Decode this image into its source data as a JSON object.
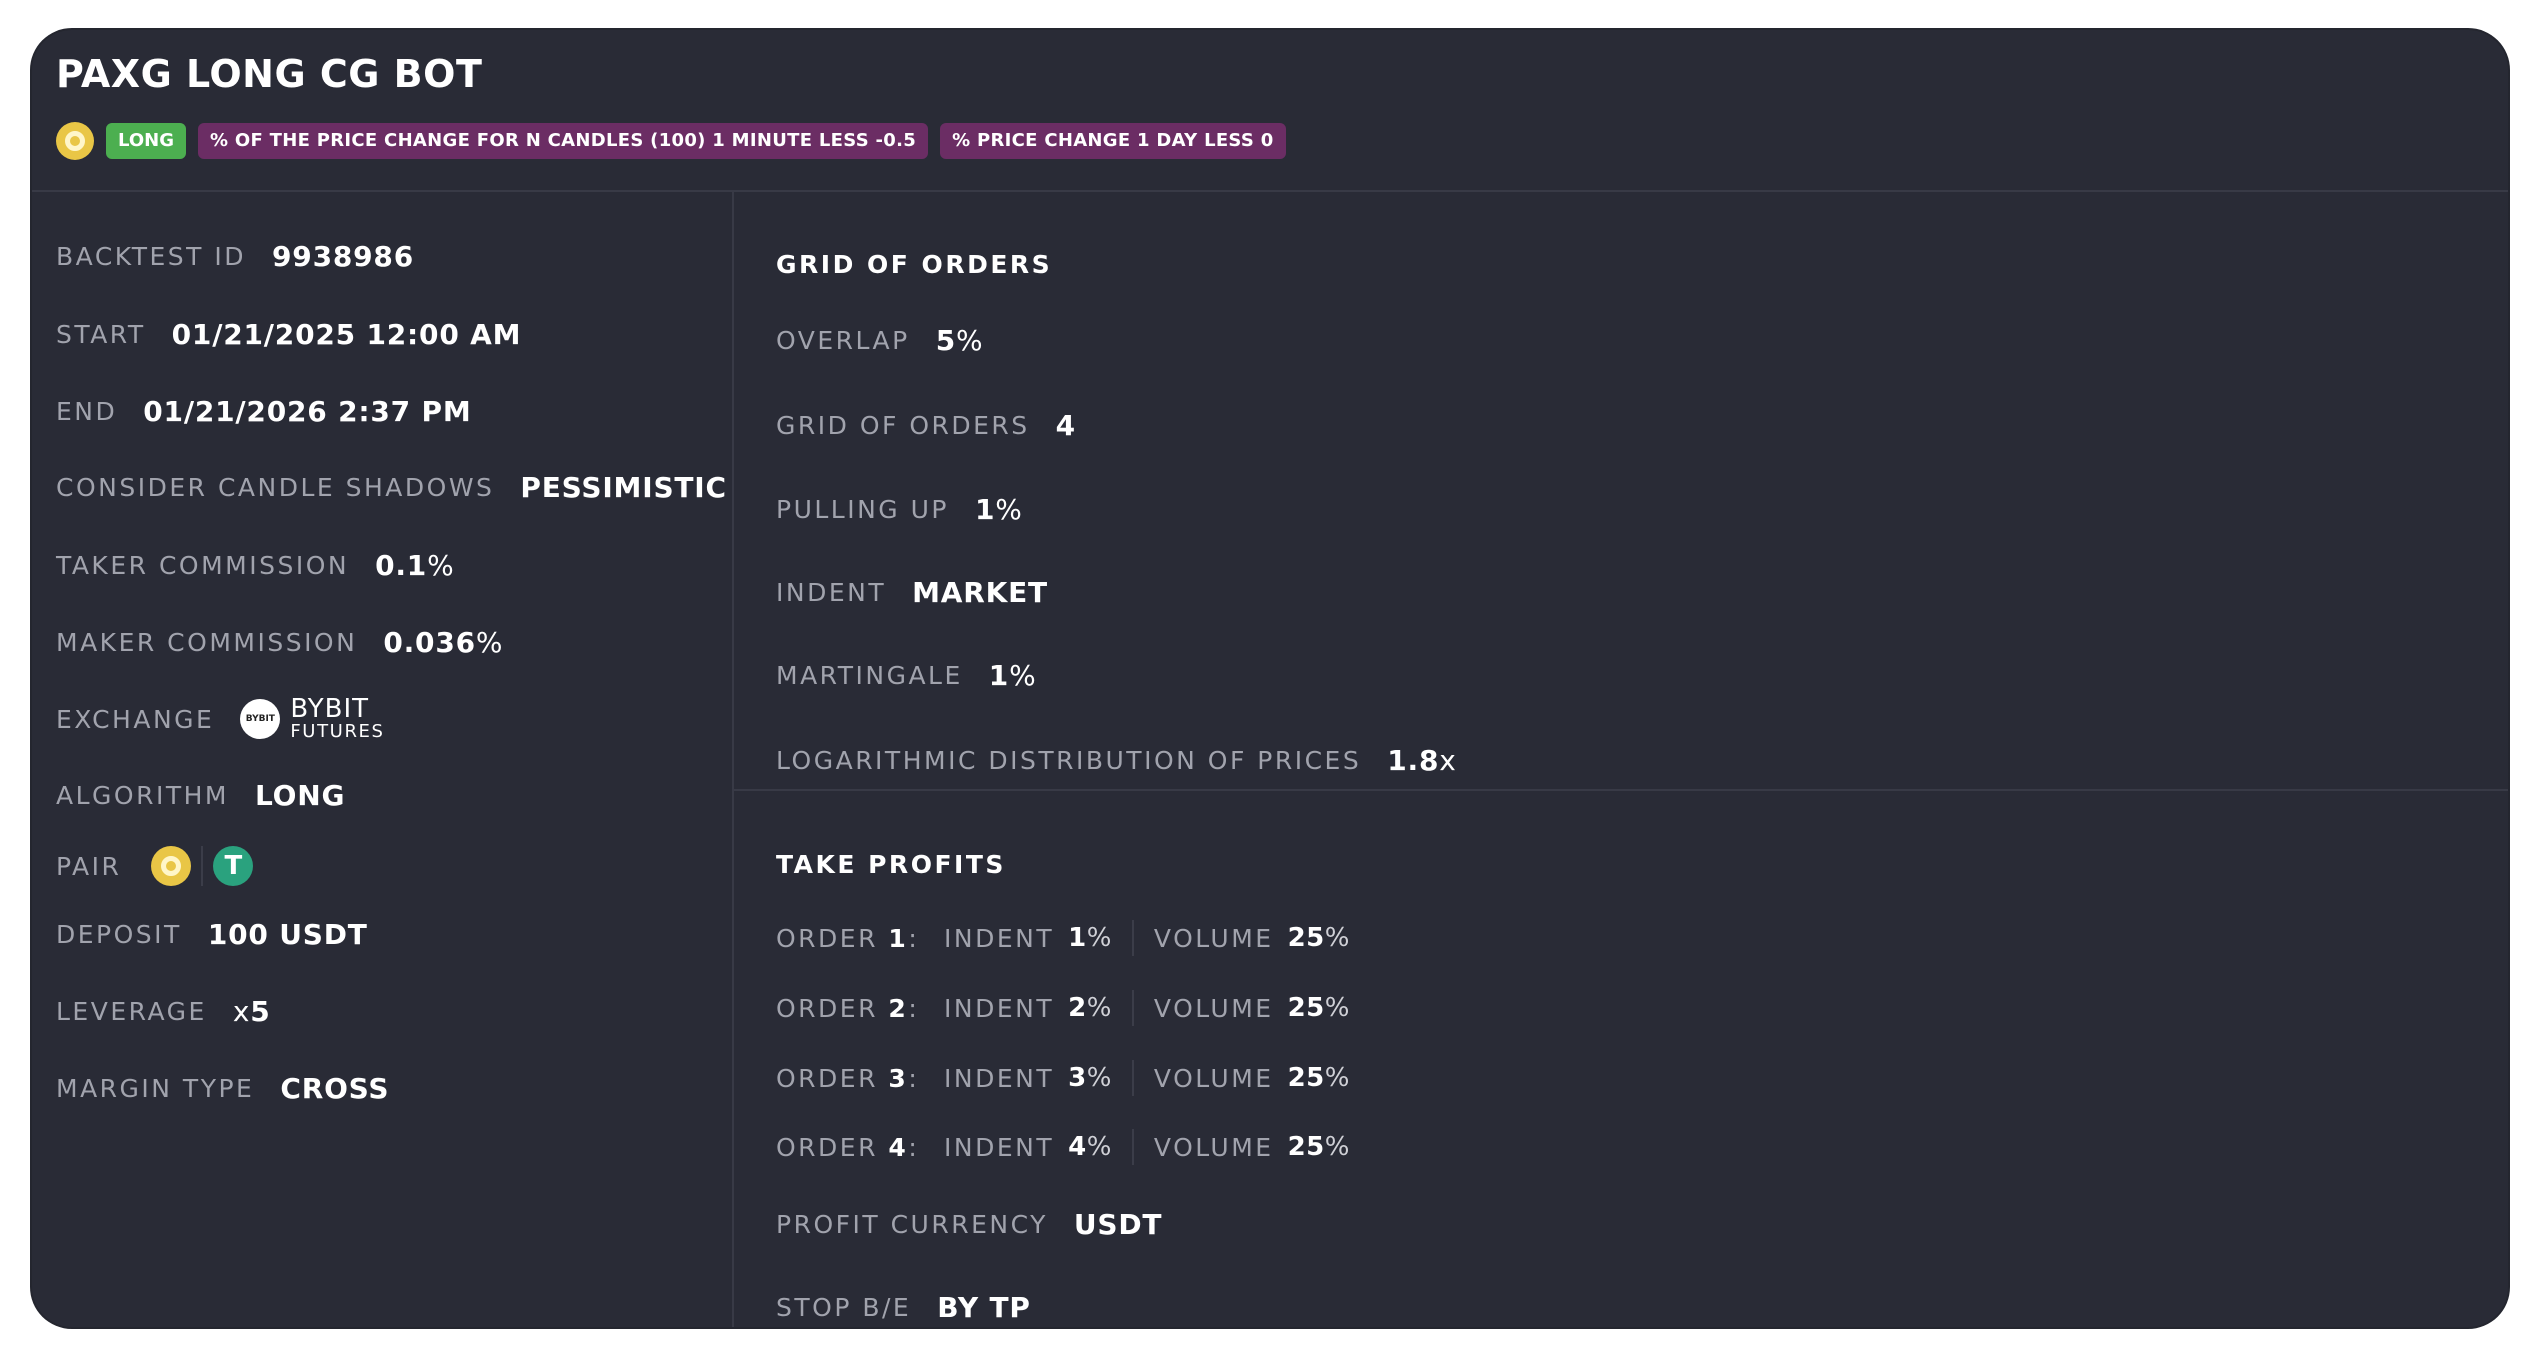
{
  "title": "PAXG LONG CG BOT",
  "badges": {
    "coin_icon": "paxg-coin-icon",
    "long": "LONG",
    "condition1": "% OF THE PRICE CHANGE FOR N CANDLES (100) 1 MINUTE LESS -0.5",
    "condition2": "% PRICE CHANGE 1 DAY LESS 0"
  },
  "left": {
    "backtest_id": {
      "label": "BACKTEST ID",
      "value": "9938986"
    },
    "start": {
      "label": "START",
      "value": "01/21/2025 12:00 AM"
    },
    "end": {
      "label": "END",
      "value": "01/21/2026 2:37 PM"
    },
    "candle_shadows": {
      "label": "CONSIDER CANDLE SHADOWS",
      "value": "PESSIMISTIC"
    },
    "taker": {
      "label": "TAKER COMMISSION",
      "value": "0.1",
      "unit": "%"
    },
    "maker": {
      "label": "MAKER COMMISSION",
      "value": "0.036",
      "unit": "%"
    },
    "exchange": {
      "label": "EXCHANGE",
      "logo_text": "BYBIT",
      "name": "BYBIT",
      "sub": "FUTURES"
    },
    "algorithm": {
      "label": "ALGORITHM",
      "value": "LONG"
    },
    "pair": {
      "label": "PAIR",
      "quote_symbol": "T"
    },
    "deposit": {
      "label": "DEPOSIT",
      "value": "100 USDT"
    },
    "leverage": {
      "label": "LEVERAGE",
      "prefix": "x",
      "value": "5"
    },
    "margin": {
      "label": "MARGIN TYPE",
      "value": "CROSS"
    }
  },
  "grid": {
    "title": "GRID OF ORDERS",
    "overlap": {
      "label": "OVERLAP",
      "value": "5",
      "unit": "%"
    },
    "orders": {
      "label": "GRID OF ORDERS",
      "value": "4"
    },
    "pulling": {
      "label": "PULLING UP",
      "value": "1",
      "unit": "%"
    },
    "indent": {
      "label": "INDENT",
      "value": "MARKET"
    },
    "martingale": {
      "label": "MARTINGALE",
      "value": "1",
      "unit": "%"
    },
    "log": {
      "label": "LOGARITHMIC DISTRIBUTION OF PRICES",
      "value": "1.8",
      "unit": "x"
    }
  },
  "tp": {
    "title": "TAKE PROFITS",
    "indent_label": "INDENT",
    "volume_label": "VOLUME",
    "orders": [
      {
        "label": "ORDER ",
        "num": "1",
        "colon": ":",
        "indent": "1",
        "volume": "25"
      },
      {
        "label": "ORDER ",
        "num": "2",
        "colon": ":",
        "indent": "2",
        "volume": "25"
      },
      {
        "label": "ORDER ",
        "num": "3",
        "colon": ":",
        "indent": "3",
        "volume": "25"
      },
      {
        "label": "ORDER ",
        "num": "4",
        "colon": ":",
        "indent": "4",
        "volume": "25"
      }
    ],
    "percent": "%",
    "currency": {
      "label": "PROFIT CURRENCY",
      "value": "USDT"
    },
    "stop": {
      "label": "STOP B/E",
      "value": "BY TP"
    }
  },
  "colors": {
    "card_bg": "#292b36",
    "long_badge": "#4caf50",
    "condition_badge": "#6b2d64",
    "paxg": "#e9c646",
    "tether": "#2aa27e"
  }
}
